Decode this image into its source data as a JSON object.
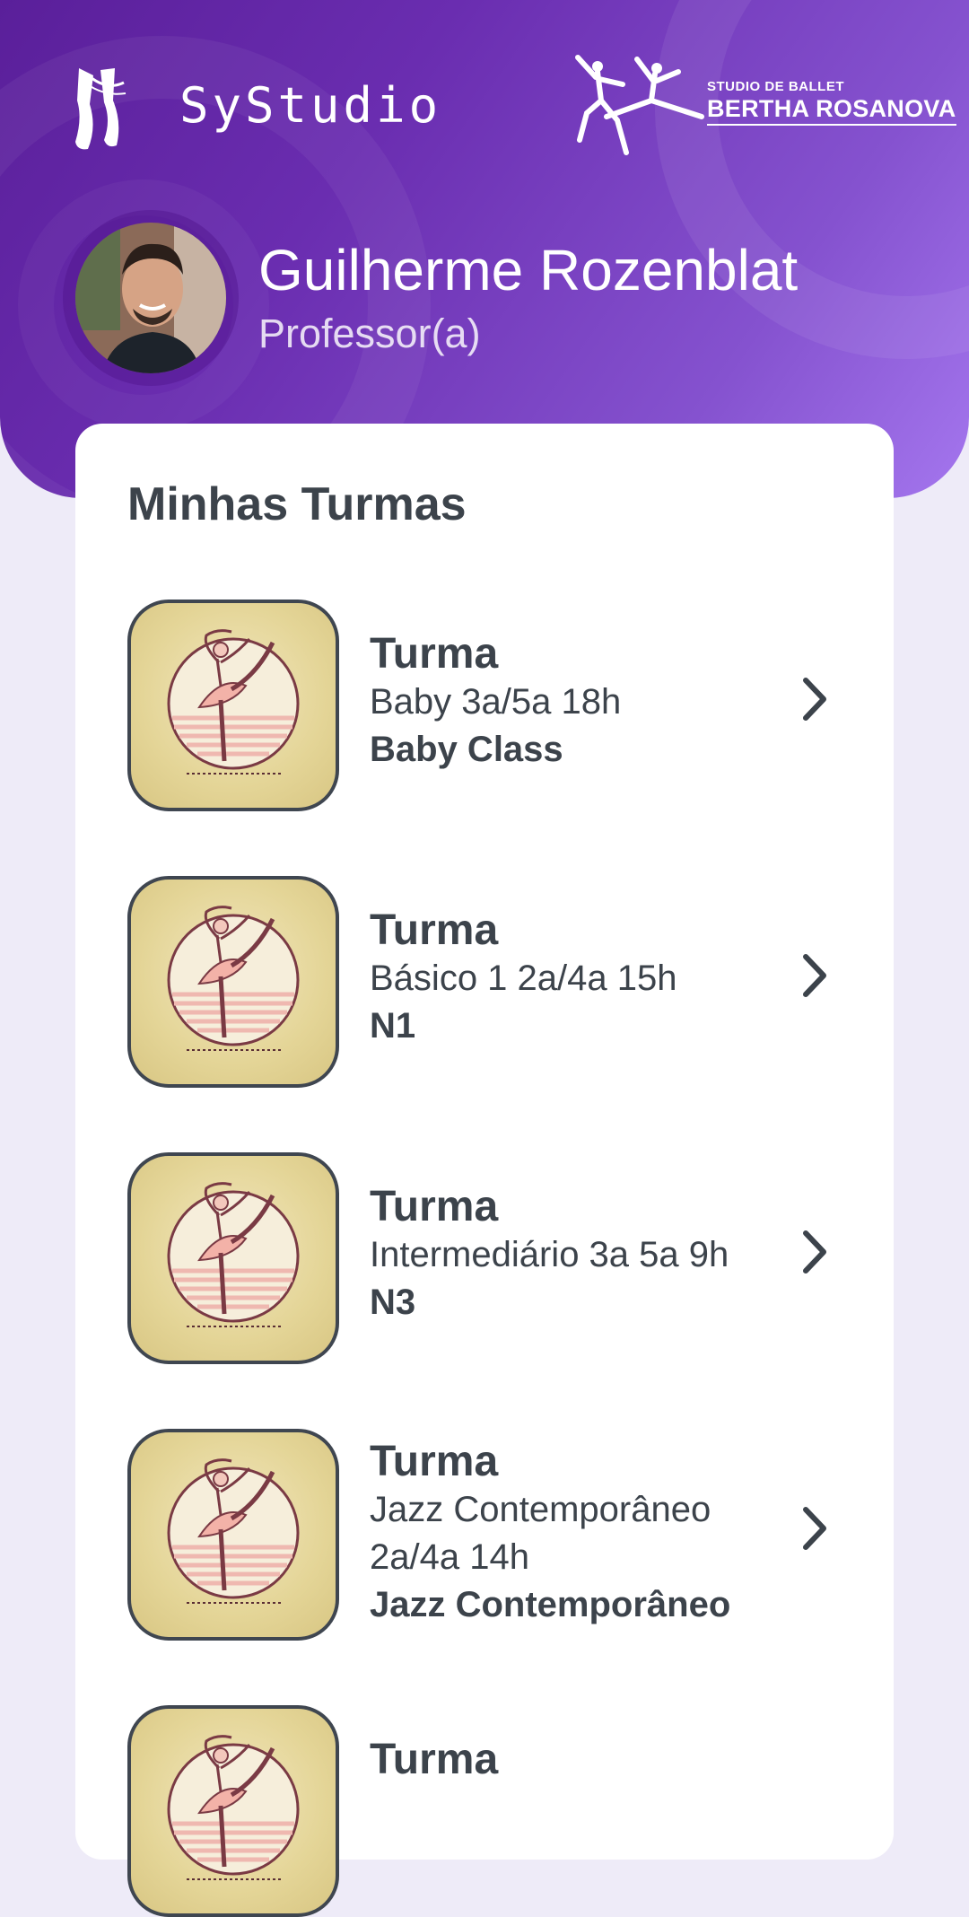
{
  "app": {
    "name": "SyStudio"
  },
  "studio_logo": {
    "top": "STUDIO DE BALLET",
    "main": "BERTHA ROSANOVA"
  },
  "user": {
    "name": "Guilherme Rozenblat",
    "role": "Professor(a)"
  },
  "section": {
    "title": "Minhas Turmas"
  },
  "classes": [
    {
      "label": "Turma",
      "schedule": "Baby 3a/5a 18h",
      "name": "Baby Class"
    },
    {
      "label": "Turma",
      "schedule": "Básico 1 2a/4a 15h",
      "name": "N1"
    },
    {
      "label": "Turma",
      "schedule": "Intermediário 3a 5a 9h",
      "name": "N3"
    },
    {
      "label": "Turma",
      "schedule": "Jazz Contemporâneo 2a/4a 14h",
      "name": "Jazz Contemporâneo"
    },
    {
      "label": "Turma",
      "schedule": "",
      "name": ""
    }
  ],
  "icons": {
    "class_thumbnail": "ballerina-icon",
    "row_action": "chevron-right-icon",
    "app_logo": "pointe-shoes-icon"
  },
  "colors": {
    "header_start": "#5a1f9a",
    "header_end": "#a476ee",
    "page_background": "#eeebf8",
    "text": "#3c434b",
    "thumb_background": "#e4d597"
  }
}
